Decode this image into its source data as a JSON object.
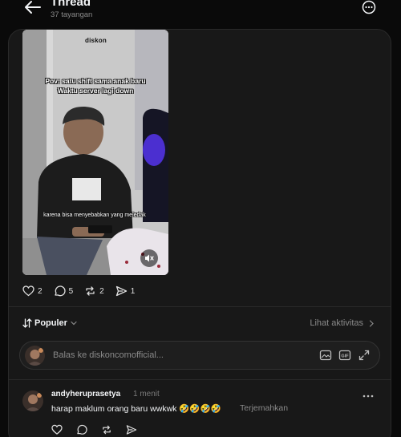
{
  "header": {
    "title": "Thread",
    "views": "37 tayangan",
    "back_icon": "arrow-left-icon",
    "more_icon": "more-circle-icon"
  },
  "post": {
    "video": {
      "brand": "diskon",
      "caption_line1": "Pov: satu shift sama anak baru",
      "caption_line2": "Waktu server lagi down",
      "subtitle": "karena bisa menyebabkan yang meledak",
      "mute_icon": "muted-speaker-icon"
    },
    "actions": {
      "likes": "2",
      "comments": "5",
      "reposts": "2",
      "shares": "1"
    }
  },
  "sort": {
    "label": "Populer",
    "activity_label": "Lihat aktivitas"
  },
  "reply_box": {
    "placeholder": "Balas ke diskoncomofficial...",
    "icons": [
      "image-icon",
      "gif-icon",
      "expand-icon"
    ]
  },
  "comments": [
    {
      "username": "andyheruprasetya",
      "time": "1 menit",
      "text": "harap maklum orang baru wwkwk 🤣🤣🤣🤣",
      "translate": "Terjemahkan"
    }
  ],
  "colors": {
    "background": "#0a0a0a",
    "card": "#181818",
    "border": "#2a2a2a",
    "text": "#f3f5f7",
    "muted": "#8a8a8a"
  }
}
